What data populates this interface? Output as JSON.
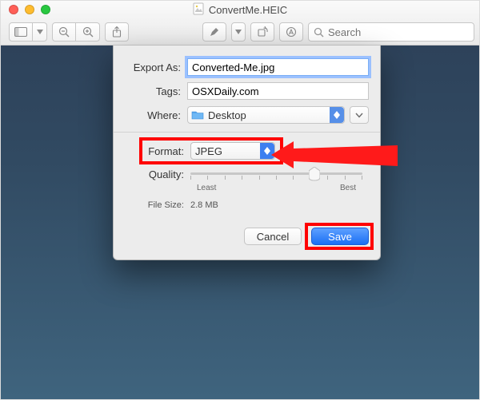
{
  "window": {
    "title": "ConvertMe.HEIC"
  },
  "toolbar": {
    "search_placeholder": "Search"
  },
  "sheet": {
    "export_as": {
      "label": "Export As:",
      "value": "Converted-Me.jpg"
    },
    "tags": {
      "label": "Tags:",
      "value": "OSXDaily.com"
    },
    "where": {
      "label": "Where:",
      "value": "Desktop"
    },
    "format": {
      "label": "Format:",
      "value": "JPEG"
    },
    "quality": {
      "label": "Quality:",
      "min_label": "Least",
      "max_label": "Best",
      "value_pct": 72
    },
    "file_size": {
      "label": "File Size:",
      "value": "2.8 MB"
    },
    "cancel_label": "Cancel",
    "save_label": "Save"
  },
  "annotations": {
    "highlight_format": true,
    "highlight_save": true,
    "arrow_color": "#ff1a1a"
  }
}
